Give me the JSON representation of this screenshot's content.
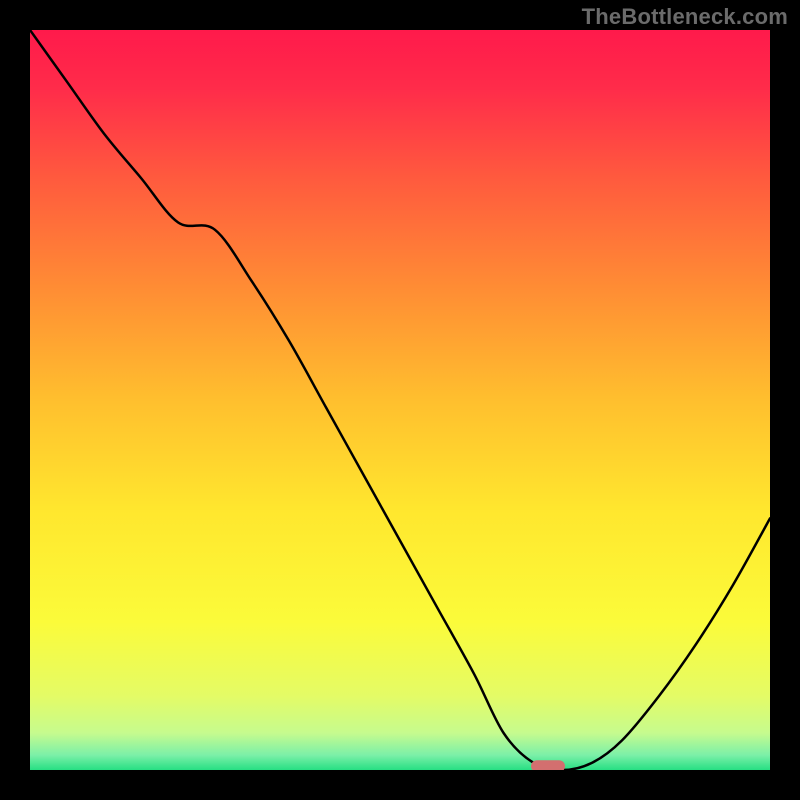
{
  "watermark": "TheBottleneck.com",
  "chart_data": {
    "type": "line",
    "title": "",
    "xlabel": "",
    "ylabel": "",
    "xlim": [
      0,
      100
    ],
    "ylim": [
      0,
      100
    ],
    "grid": false,
    "legend": false,
    "background_gradient": {
      "stops": [
        {
          "pct": 0.0,
          "color": "#ff1a4b"
        },
        {
          "pct": 0.08,
          "color": "#ff2c4a"
        },
        {
          "pct": 0.2,
          "color": "#ff5a3e"
        },
        {
          "pct": 0.35,
          "color": "#ff8d34"
        },
        {
          "pct": 0.5,
          "color": "#ffbf2e"
        },
        {
          "pct": 0.65,
          "color": "#ffe72e"
        },
        {
          "pct": 0.8,
          "color": "#fbfb3a"
        },
        {
          "pct": 0.9,
          "color": "#e4fb66"
        },
        {
          "pct": 0.95,
          "color": "#c6fb8e"
        },
        {
          "pct": 0.98,
          "color": "#7bf0a8"
        },
        {
          "pct": 1.0,
          "color": "#27df83"
        }
      ]
    },
    "series": [
      {
        "name": "bottleneck-curve",
        "color": "#000000",
        "x": [
          0,
          5,
          10,
          15,
          20,
          25,
          30,
          35,
          40,
          45,
          50,
          55,
          60,
          64,
          68,
          72,
          76,
          80,
          85,
          90,
          95,
          100
        ],
        "values": [
          100,
          93,
          86,
          80,
          74,
          73,
          66,
          58,
          49,
          40,
          31,
          22,
          13,
          5,
          1,
          0,
          1,
          4,
          10,
          17,
          25,
          34
        ]
      }
    ],
    "annotations": [
      {
        "name": "optimal-marker",
        "shape": "rounded-rect",
        "x": 70,
        "y": 0.5,
        "color": "#d36f6f"
      }
    ]
  }
}
